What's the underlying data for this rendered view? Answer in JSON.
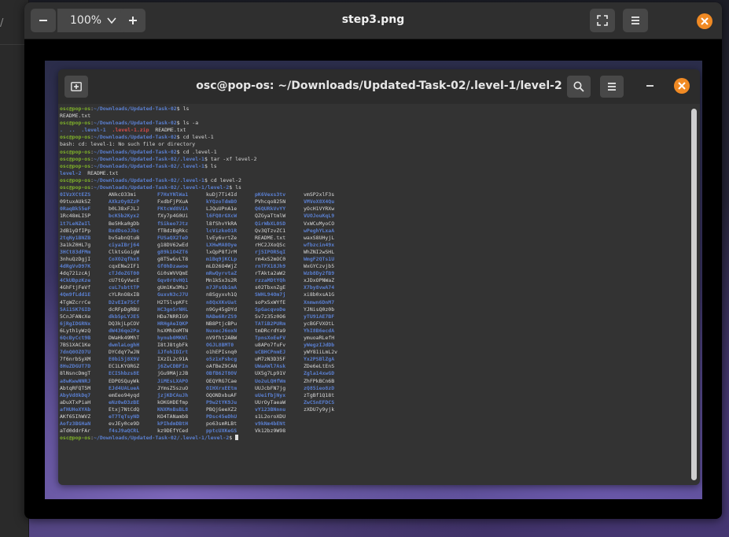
{
  "background_window": {
    "crumb": "/"
  },
  "viewer": {
    "title": "step3.png",
    "zoom_label": "100%",
    "buttons": [
      "zoom-out-icon",
      "zoom-in-icon",
      "fullscreen-icon",
      "menu-icon",
      "close-icon"
    ]
  },
  "terminal": {
    "title": "osc@pop-os: ~/Downloads/Updated-Task-02/.level-1/level-2",
    "prompt_user": "osc@pop-os",
    "lines": [
      {
        "type": "cmd",
        "path": "~/Downloads/Updated-Task-02",
        "cmd": "ls"
      },
      {
        "type": "out",
        "text": "README.txt"
      },
      {
        "type": "cmd",
        "path": "~/Downloads/Updated-Task-02",
        "cmd": "ls -a"
      },
      {
        "type": "dirs",
        "items": [
          {
            "t": ".",
            "c": "dir"
          },
          {
            "t": "..",
            "c": "dir"
          },
          {
            "t": ".level-1",
            "c": "dir"
          },
          {
            "t": ".level-1.zip",
            "c": "dir2"
          },
          {
            "t": "README.txt",
            "c": ""
          }
        ]
      },
      {
        "type": "cmd",
        "path": "~/Downloads/Updated-Task-02",
        "cmd": "cd level-1"
      },
      {
        "type": "out",
        "text": "bash: cd: level-1: No such file or directory"
      },
      {
        "type": "cmd",
        "path": "~/Downloads/Updated-Task-02",
        "cmd": "cd .level-1"
      },
      {
        "type": "cmd",
        "path": "~/Downloads/Updated-Task-02/.level-1",
        "cmd": "tar -xf level-2"
      },
      {
        "type": "cmd",
        "path": "~/Downloads/Updated-Task-02/.level-1",
        "cmd": "ls"
      },
      {
        "type": "dirs",
        "items": [
          {
            "t": "level-2",
            "c": "dir"
          },
          {
            "t": "README.txt",
            "c": ""
          }
        ]
      },
      {
        "type": "cmd",
        "path": "~/Downloads/Updated-Task-02/.level-1",
        "cmd": "cd level-2"
      },
      {
        "type": "cmd",
        "path": "~/Downloads/Updated-Task-02/.level-1/level-2",
        "cmd": "ls"
      }
    ],
    "listing": [
      [
        "0IVzXCtEZS",
        "ANkcO33mi",
        "F7HxYNlWa1",
        "kuDj7Ti4Id",
        "pK6Vexs3tv",
        "vmSP2xlF3s"
      ],
      [
        "09tuxAUkSZ",
        "AXkzOy8ZzP",
        "FxdbFjPXuA",
        "kYQzoTdmBO",
        "PVhcqo825N",
        "VMVoX8X4Qu"
      ],
      [
        "0RaqBk55eF",
        "b0L38xFJLJ",
        "FKtcWd8ViA",
        "LJQuUPnA1e",
        "Q6QURkVvYY",
        "yOcH1VYRXw"
      ],
      [
        "1Rc48mLISP",
        "bcK5b2Kyx2",
        "fXy7p4G0Ui",
        "l6FQ8rGXcW",
        "QZGyaTtmlW",
        "VUOJouKqL9"
      ],
      [
        "1t7LeNZeIl",
        "Be5Hka0gDb",
        "fSikeo7Jtz",
        "l8fShvYkRA",
        "QirWbXL0SD",
        "VxWCuMyoCO"
      ],
      [
        "2dB1yDfIPp",
        "BxdDsoJJbc",
        "fTBdzBgRkc",
        "lcVizkoO1R",
        "Qv3QTzvZC1",
        "wPeghYLxaA"
      ],
      [
        "2tqNy1BNZB",
        "bv5abnQtuB",
        "FUSaQX2TeD",
        "lvEy6vrtZe",
        "README.txt",
        "waxS8UHyjL"
      ],
      [
        "3a1kZ0HL7g",
        "ciyaIBrj64",
        "g18DV62wEd",
        "LXHwMA8Oye",
        "rHC2JXoQSc",
        "wfbzcin49x"
      ],
      [
        "3HCt83dFMm",
        "ClktsGoigW",
        "g89k1O4ZT6",
        "lxQpP8fJrM",
        "rj5IPORSqI",
        "WhZNI2wSHL"
      ],
      [
        "3nhuQzDgjI",
        "CoXO2qfhx8",
        "g8T5wGvLT8",
        "m1Bq9jKCLp",
        "rm4xS2mOC0",
        "WmgF2QTs1U"
      ],
      [
        "4dRgVvD97K",
        "cqxENw2IF1",
        "Gf0hDzawoe",
        "mLD26O4WjZ",
        "rnTFX18Jh9",
        "WxGYCzvjb5"
      ],
      [
        "4dq721zcAj",
        "cTJdoZGT00",
        "Gi0sWVVQmE",
        "mRwQyrvtaZ",
        "rTAkta2aW2",
        "Wzb8Dy2fB9"
      ],
      [
        "4CkUBpzKze",
        "cU7tGyVwcE",
        "Gqv0r8vHQ1",
        "Mn1kSx3s2R",
        "rzzaMDtYQh",
        "xJDxOPNWaZ"
      ],
      [
        "4GhFtjFeVf",
        "cuL7sbttTP",
        "gUm1Kw3MsJ",
        "n7JFsGbimA",
        "s02TbxnZgE",
        "X7by8vwA74"
      ],
      [
        "4Qm9fLdd1E",
        "cYLRnO8xIB",
        "GuxvN3cJ7U",
        "n8Sgyxvh1Q",
        "SWHL94Om7j",
        "xi8b0xsA1G"
      ],
      [
        "4TgWZcrrCe",
        "D2vEIm75Cf",
        "H2T5lvpKFt",
        "n8QxXKvUat",
        "soPx5xWYfE",
        "Xnmwn6DnM7"
      ],
      [
        "5Ai1SK7GID",
        "dcRFpDgRBU",
        "HC3gn5rNHL",
        "n9Gy45gDYd",
        "SpGacqvoDe",
        "YJNisQ0z0b"
      ],
      [
        "5CnJFANcXe",
        "dkb5pLYJE5",
        "HDa7NRRIG0",
        "NABe6RrZS9",
        "Sv7z35z0O6",
        "yTU91AE7BF"
      ],
      [
        "6jRgIDGRNx",
        "DQ3kjLpCOV",
        "HRHgAeIQKP",
        "NB8PtjcBPu",
        "TATiB2PURm",
        "ycBGFVXOtL"
      ],
      [
        "6Lyth1yWzQ",
        "dW436qo2Pa",
        "hsXMhOoMTN",
        "NuxecJ6oxN",
        "tmDRcrdYa9",
        "YhI8B6ecdA"
      ],
      [
        "6QcByCct9B",
        "DWaHk49MhT",
        "hynub0MKNl",
        "nV9fht2ABW",
        "TpnsXoEeFV",
        "ymuoaRLefH"
      ],
      [
        "7BS1XAC1Ke",
        "dwmlaLoghH",
        "I8tJ8tgbFk",
        "OGJL8BMT0",
        "u8APo7fuFv",
        "yWegzIJdDb"
      ],
      [
        "7dnQ0OZO7U",
        "DYCdqY7wJN",
        "iJfohIDIrt",
        "o1hEPIsnq0",
        "uCBHCPnmEJ",
        "yWY81iLmL2v"
      ],
      [
        "7f6nrbSyXM",
        "E0bi5j8X9V",
        "IXzIL2c91A",
        "o5z1xFsbcg",
        "uM7zN3D35F",
        "Yx2PSBlZgA"
      ],
      [
        "8HuZDGUT7D",
        "EC1LKYORGZ",
        "j6ZwCDBFIn",
        "oAfBeZ9CAN",
        "UWaAWl7Ask",
        "ZDe6eLtEnS"
      ],
      [
        "8lNsncDmgT",
        "ECIShbzs8E",
        "jGu9MAjzJB",
        "OBfB62T8OV",
        "UX5g7Lp91V",
        "Zgla14xwGD"
      ],
      [
        "a8wKwwNNRJ",
        "EDPOSQuyWk",
        "JiMEsLXAPO",
        "OEQYRG7Cae",
        "Uo2uLQHfWm",
        "ZhFPkBCn6B"
      ],
      [
        "AbtqRFQT5M",
        "EJd4UALueA",
        "JYmsZ5szuO",
        "OIHXrxEEtm",
        "UUJcbFN7jg",
        "zQ85ieo8zD"
      ],
      [
        "AbyVd8kDq7",
        "emEeo94yqd",
        "jzjKDCAuJh",
        "OQONDxbuAF",
        "uUeifbjNyx",
        "zTgBf1Q18t"
      ],
      [
        "aDuXTxPiaH",
        "eNz0wD3zBE",
        "kOKGHDEfmp",
        "P9w2tYK9Ju",
        "UUrOyTaeaW",
        "ZwCSnEFDCS"
      ],
      [
        "afHUHoXYAb",
        "Etxj7NtCdQ",
        "KNXMnBsBL8",
        "PBQjGeeXZ2",
        "vY123BNnnu",
        "zXDU7y9yjk"
      ],
      [
        "AKf65IhWVZ",
        "eT7TqTsyND",
        "KO4TANamb8",
        "PDsc45eDhU",
        "s1L2oroXDU",
        ""
      ],
      [
        "Aofz3BGHaN",
        "evJEy0ce9D",
        "kPIhdmDBtH",
        "po63smRLBt",
        "v9kNm4bENt",
        ""
      ],
      [
        "aTd0ddrFAr",
        "f4sJ9aQCRL",
        "kz9DEfYCed",
        "pptcUXKeGS",
        "Vk12bz9W98",
        ""
      ]
    ],
    "final_prompt_path": "~/Downloads/Updated-Task-02/.level-1/level-2"
  },
  "colors": {
    "accent": "#f08a24",
    "prompt_user": "#7fb22a",
    "prompt_path": "#5a7fd0",
    "archive": "#d34b4b"
  }
}
